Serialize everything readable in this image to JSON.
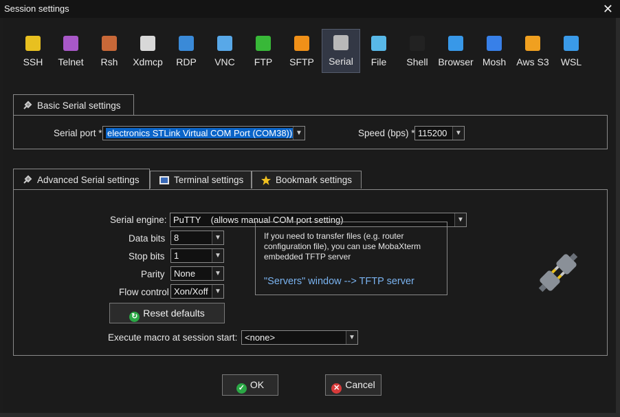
{
  "window": {
    "title": "Session settings"
  },
  "toolbar": [
    {
      "label": "SSH",
      "icon": "ssh-key-icon",
      "color": "#e8c020"
    },
    {
      "label": "Telnet",
      "icon": "telnet-gem-icon",
      "color": "#a858c8"
    },
    {
      "label": "Rsh",
      "icon": "rsh-gear-icon",
      "color": "#c86838"
    },
    {
      "label": "Xdmcp",
      "icon": "xdmcp-x-icon",
      "color": "#d8d8d8"
    },
    {
      "label": "RDP",
      "icon": "rdp-monitor-icon",
      "color": "#3a8ad8"
    },
    {
      "label": "VNC",
      "icon": "vnc-screen-icon",
      "color": "#58a8e8"
    },
    {
      "label": "FTP",
      "icon": "ftp-globe-icon",
      "color": "#38b838"
    },
    {
      "label": "SFTP",
      "icon": "sftp-globe-icon",
      "color": "#f09018"
    },
    {
      "label": "Serial",
      "icon": "serial-plug-icon",
      "color": "#b8b8b8",
      "selected": true
    },
    {
      "label": "File",
      "icon": "file-monitor-icon",
      "color": "#58b8e8"
    },
    {
      "label": "Shell",
      "icon": "shell-terminal-icon",
      "color": "#222222"
    },
    {
      "label": "Browser",
      "icon": "browser-globe-icon",
      "color": "#3898e8"
    },
    {
      "label": "Mosh",
      "icon": "mosh-satellite-icon",
      "color": "#3880e8"
    },
    {
      "label": "Aws S3",
      "icon": "aws-s3-cubes-icon",
      "color": "#f0a020"
    },
    {
      "label": "WSL",
      "icon": "wsl-windows-icon",
      "color": "#3a9ae8"
    }
  ],
  "basic": {
    "tab_label": "Basic Serial settings",
    "port_label": "Serial port *",
    "port_value": "electronics STLink Virtual COM Port (COM38))",
    "speed_label": "Speed (bps) *",
    "speed_value": "115200"
  },
  "advanced": {
    "tabs": [
      "Advanced Serial settings",
      "Terminal settings",
      "Bookmark settings"
    ],
    "engine_label": "Serial engine:",
    "engine_value": "PuTTY    (allows manual COM port setting)",
    "databits_label": "Data bits",
    "databits_value": "8",
    "stopbits_label": "Stop bits",
    "stopbits_value": "1",
    "parity_label": "Parity",
    "parity_value": "None",
    "flow_label": "Flow control",
    "flow_value": "Xon/Xoff",
    "reset_label": "Reset defaults",
    "info_text": "If you need to transfer files (e.g. router configuration file), you can use MobaXterm embedded TFTP server",
    "info_link": "\"Servers\" window  -->  TFTP server",
    "macro_label": "Execute macro at session start:",
    "macro_value": "<none>"
  },
  "buttons": {
    "ok": "OK",
    "cancel": "Cancel"
  },
  "colors": {
    "accent": "#7ab3f0",
    "ok_green": "#2aa845",
    "cancel_red": "#d83a3a"
  }
}
